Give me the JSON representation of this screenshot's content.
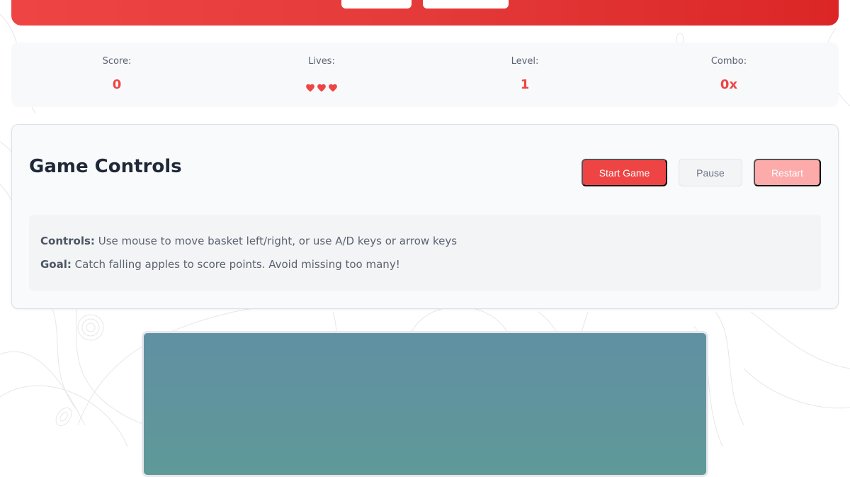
{
  "stats": {
    "score_label": "Score:",
    "score_value": "0",
    "lives_label": "Lives:",
    "lives_count": 3,
    "level_label": "Level:",
    "level_value": "1",
    "combo_label": "Combo:",
    "combo_value": "0x"
  },
  "controls": {
    "title": "Game Controls",
    "start_label": "Start Game",
    "pause_label": "Pause",
    "restart_label": "Restart",
    "controls_heading": "Controls:",
    "controls_text": "Use mouse to move basket left/right, or use A/D keys or arrow keys",
    "goal_heading": "Goal:",
    "goal_text": "Catch falling apples to score points. Avoid missing too many!"
  },
  "colors": {
    "accent": "#ef4444",
    "heart": "#ef4444",
    "text_dark": "#1f2937",
    "game_bg_top": "#6090a3",
    "game_bg_bottom": "#5f9998"
  },
  "icons": {
    "heart": "heart-icon"
  }
}
